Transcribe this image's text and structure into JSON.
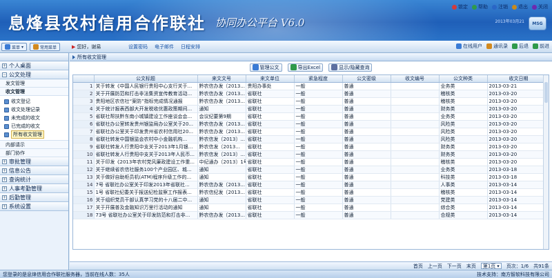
{
  "banner": {
    "title": "息烽县农村信用合作联社",
    "subtitle": "协同办公平台 V6.0",
    "date": "2013年03月21",
    "msg_label": "MSG",
    "top_links": [
      {
        "label": "锁定",
        "color": "#d23b3b",
        "icon": "lock-icon"
      },
      {
        "label": "帮助",
        "color": "#2f9a4a",
        "icon": "help-icon"
      },
      {
        "label": "注销",
        "color": "#2a66c6",
        "icon": "logout-icon"
      },
      {
        "label": "退出",
        "color": "#c88a1c",
        "icon": "exit-icon"
      },
      {
        "label": "关闭",
        "color": "#6d2ab0",
        "icon": "close-icon"
      }
    ]
  },
  "toolbar": {
    "left_buttons": [
      "菜单",
      "常用菜单"
    ],
    "greeting": "您好，谢易",
    "menu": [
      "设置密码",
      "电子邮件",
      "日程安排"
    ],
    "right": [
      {
        "label": "在线用户",
        "color": "#3a7bd5",
        "icon": "online-users-icon"
      },
      {
        "label": "通讯录",
        "color": "#d2891e",
        "icon": "address-book-icon"
      },
      {
        "label": "后退",
        "color": "#2f9a4a",
        "icon": "back-icon"
      },
      {
        "label": "前进",
        "color": "#2f9a4a",
        "icon": "forward-icon"
      }
    ]
  },
  "sidebar": {
    "sections": [
      {
        "label": "个人桌面",
        "expanded": false
      },
      {
        "label": "公文处理",
        "expanded": true
      }
    ],
    "subs": [
      "发文管理",
      "收文管理"
    ],
    "items": [
      "收文登记",
      "收文处理记录",
      "未完成的收文",
      "已完成的收文",
      "所有收文管理"
    ],
    "subs_after": [
      "内部请示",
      "部门协作"
    ],
    "sections_after": [
      "审批管理",
      "信息公告",
      "查询统计",
      "人事考勤管理",
      "后勤管理",
      "系统设置"
    ]
  },
  "main": {
    "page_title": "所有收文管理",
    "actions": [
      {
        "label": "管理公文",
        "color": "#3a7bd5",
        "icon": "manage-doc-icon"
      },
      {
        "label": "导出Excel",
        "color": "#2f9a4a",
        "icon": "excel-export-icon"
      },
      {
        "label": "显示/隐藏查询",
        "color": "#5d6fa0",
        "icon": "search-toggle-icon"
      }
    ],
    "columns": [
      "",
      "公文标题",
      "来文文号",
      "来文单位",
      "紧急程度",
      "公文密级",
      "收文编号",
      "公文种类",
      "收文日期"
    ],
    "rows": [
      [
        "1",
        "关于转发《中国人民银行贵阳中心支行关于...",
        "黔农信办发〔2013...",
        "贵阳办事处",
        "一般",
        "普通",
        "",
        "业务类",
        "2013-03-21"
      ],
      [
        "2",
        "关于开展防范和打击非法集资宣传教育活动...",
        "黔农信办发〔2013...",
        "省联社",
        "一般",
        "普通",
        "",
        "稽核类",
        "2013-03-20"
      ],
      [
        "3",
        "贵阳地区农信社“案防”指标完成情况通报",
        "黔农信办发〔2013...",
        "省联社",
        "一般",
        "普通",
        "",
        "稽核类",
        "2013-03-20"
      ],
      [
        "4",
        "关于统计报表西部大开发税收优惠政策期间...",
        "通知",
        "省联社",
        "一般",
        "普通",
        "",
        "财务类",
        "2013-03-20"
      ],
      [
        "5",
        "省联社帮扶黔东南小城镇建设工作座谈会会...",
        "会议纪要第9期",
        "省联社",
        "一般",
        "普通",
        "",
        "业务类",
        "2013-03-20"
      ],
      [
        "6",
        "省联社办公室转发贵州银监局办公室关于20...",
        "黔农信办发〔2013...",
        "省联社",
        "一般",
        "普通",
        "",
        "风险类",
        "2013-03-20"
      ],
      [
        "7",
        "省联社办公室关于印发贵州省农村信用社20...",
        "黔农信办发〔2013...",
        "省联社",
        "一般",
        "普通",
        "",
        "风险类",
        "2013-03-20"
      ],
      [
        "8",
        "省联社转发中国银监会农村中小金融机构...",
        "黔农信发〔2013〕...",
        "省联社",
        "一般",
        "普通",
        "",
        "风险类",
        "2013-03-20"
      ],
      [
        "9",
        "省联社转发人行贵阳中支关于2013年1月银...",
        "黔农信发〔2013...",
        "省联社",
        "一般",
        "普通",
        "",
        "财务类",
        "2013-03-20"
      ],
      [
        "10",
        "省联社转发人行贵阳中支关于2013年人民币...",
        "黔农信发〔2013〕...",
        "省联社",
        "一般",
        "普通",
        "",
        "财务类",
        "2013-03-20"
      ],
      [
        "11",
        "关于印发《2013年农村党风廉政建设工作重...",
        "中纪通办〔2013〕1号",
        "省联社",
        "一般",
        "普通",
        "",
        "稽核类",
        "2013-03-20"
      ],
      [
        "12",
        "关于继续省农信社服务100个产业园区、城...",
        "通知",
        "省联社",
        "一般",
        "普通",
        "",
        "业务类",
        "2013-03-18"
      ],
      [
        "13",
        "关于做好自助柜员机(ATM)程序升级工作的...",
        "通知",
        "省联社",
        "一般",
        "普通",
        "",
        "科技类",
        "2013-03-18"
      ],
      [
        "14",
        "7号 省联社办公室关于印发2013年省联社...",
        "黔农信办发〔2013...",
        "省联社",
        "一般",
        "普通",
        "",
        "人事类",
        "2013-03-14"
      ],
      [
        "15",
        "1号 省联社纪委关于报送纪检监察工作报表...",
        "黔农信纪发〔2013...",
        "省联社",
        "一般",
        "普通",
        "",
        "稽核类",
        "2013-03-14"
      ],
      [
        "16",
        "关于组织党员干部认真学习党的十八届二中...",
        "通知",
        "省联社",
        "一般",
        "普通",
        "",
        "党建类",
        "2013-03-14"
      ],
      [
        "17",
        "关于开展普及金融知识万里行活动的通知",
        "通知",
        "省联社",
        "一般",
        "普通",
        "",
        "综合类",
        "2013-03-14"
      ],
      [
        "18",
        "73号 省联社办公室关于印发防范和打击非...",
        "黔农信办发〔2013...",
        "省联社",
        "一般",
        "普通",
        "",
        "合规类",
        "2013-03-14"
      ]
    ],
    "pager": {
      "first": "首页",
      "prev": "上一页",
      "next": "下一页",
      "last": "末页",
      "current": "第1页",
      "page_info": "页次：1/6",
      "total": "共91条"
    }
  },
  "status": {
    "left": "您登录的是息烽信用合作联社服务器，当前在线人数：35人",
    "right": "技术支持：南方智软科技有限公司"
  }
}
